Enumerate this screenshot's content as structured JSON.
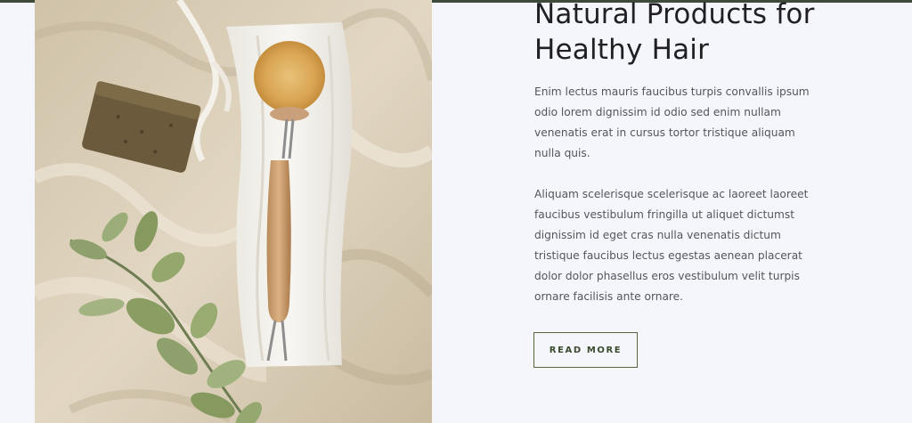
{
  "section": {
    "heading": "Natural Products for Healthy Hair",
    "paragraphs": [
      "Enim lectus mauris faucibus turpis convallis ipsum odio lorem dignissim id odio sed enim nullam venenatis erat in cursus tortor tristique aliquam nulla quis.",
      "Aliquam scelerisque scelerisque ac laoreet laoreet faucibus vestibulum fringilla ut aliquet dictumst dignissim id eget cras nulla venenatis dictum tristique faucibus lectus egestas aenean placerat dolor dolor phasellus eros vestibulum velit turpis ornare facilisis ante ornare."
    ],
    "button_label": "READ MORE"
  },
  "colors": {
    "background": "#f5f6fb",
    "heading": "#1f1f24",
    "body_text": "#55555d",
    "button_border": "#55653e",
    "button_text": "#3b4a2c",
    "top_rule": "#3d4a3a"
  }
}
